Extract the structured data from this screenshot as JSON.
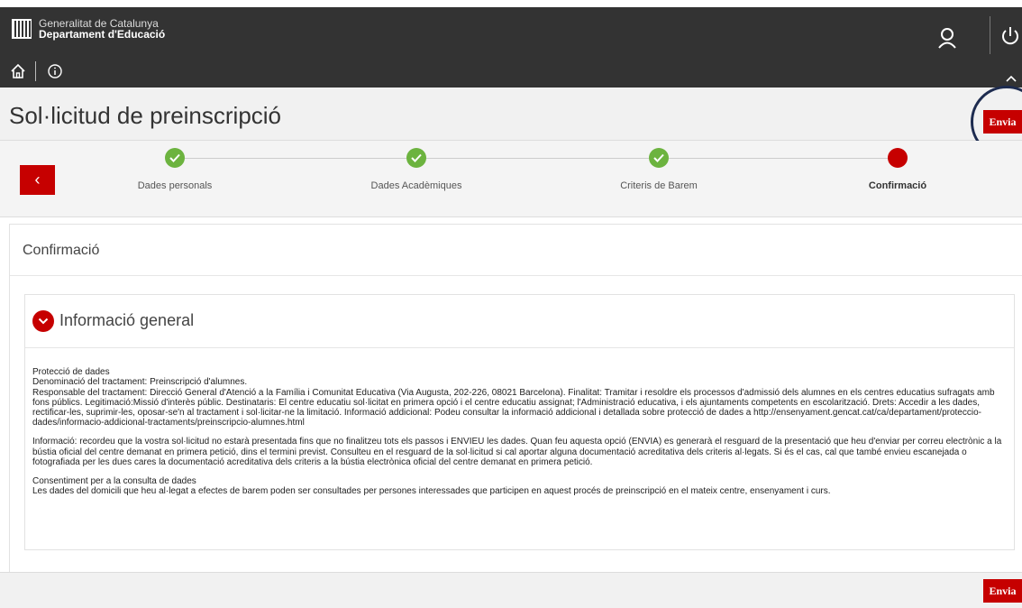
{
  "header": {
    "org_line1": "Generalitat de Catalunya",
    "org_line2": "Departament d'Educació"
  },
  "page": {
    "title": "Sol·licitud de preinscripció"
  },
  "actions": {
    "send_label": "Envia",
    "back_label": "‹"
  },
  "steps": [
    {
      "label": "Dades personals",
      "state": "done"
    },
    {
      "label": "Dades Acadèmiques",
      "state": "done"
    },
    {
      "label": "Criteris de Barem",
      "state": "done"
    },
    {
      "label": "Confirmació",
      "state": "current"
    }
  ],
  "confirmation": {
    "title": "Confirmació",
    "panel_title": "Informació general",
    "paragraphs": [
      "Protecció de dades\nDenominació del tractament: Preinscripció d'alumnes.\nResponsable del tractament: Direcció General d'Atenció a la Família i Comunitat Educativa (Via Augusta, 202-226, 08021 Barcelona). Finalitat: Tramitar i resoldre els processos d'admissió dels alumnes en els centres educatius sufragats amb fons públics. Legitimació:Missió d'interès públic. Destinataris: El centre educatiu sol·licitat en primera opció i el centre educatiu assignat; l'Administració educativa, i els ajuntaments competents en escolarització. Drets: Accedir a les dades, rectificar-les, suprimir-les, oposar-se'n al tractament i sol·licitar-ne la limitació. Informació addicional: Podeu consultar la informació addicional i detallada sobre protecció de dades a http://ensenyament.gencat.cat/ca/departament/proteccio-dades/informacio-addicional-tractaments/preinscripcio-alumnes.html",
      "Informació: recordeu que la vostra sol·licitud no estarà presentada fins que no finalitzeu tots els passos i ENVIEU les dades. Quan feu aquesta opció (ENVIA) es generarà el resguard de la presentació que heu d'enviar per correu electrònic a la bústia oficial del centre demanat en primera petició, dins el termini previst. Consulteu en el resguard de la sol·licitud si cal aportar alguna documentació acreditativa dels criteris al·legats. Si és el cas, cal que també envieu escanejada o fotografiada per les dues cares la documentació acreditativa dels criteris a la bústia electrònica oficial del centre demanat en primera petició.",
      "Consentiment per a la consulta de dades\nLes dades del domicili que heu al·legat a efectes de barem poden ser consultades per persones interessades que participen en aquest procés de preinscripció en el mateix centre, ensenyament i curs."
    ]
  },
  "colors": {
    "brand_red": "#c60000",
    "done_green": "#6cb33f",
    "header_bg": "#333333"
  }
}
